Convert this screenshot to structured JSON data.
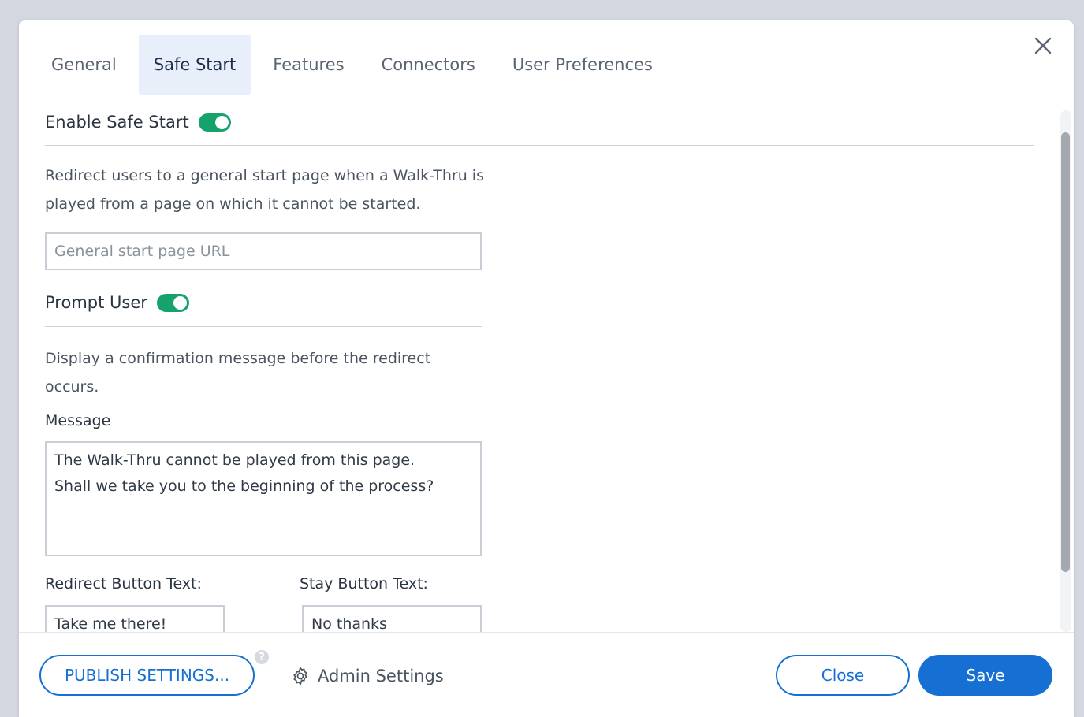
{
  "tabs": [
    {
      "label": "General"
    },
    {
      "label": "Safe Start"
    },
    {
      "label": "Features"
    },
    {
      "label": "Connectors"
    },
    {
      "label": "User Preferences"
    }
  ],
  "active_tab": "Safe Start",
  "safe_start": {
    "enable_label": "Enable Safe Start",
    "enable_on": true,
    "description": "Redirect users to a general start page when a Walk-Thru is played from a page on which it cannot be started.",
    "url_placeholder": "General start page URL",
    "url_value": ""
  },
  "prompt": {
    "label": "Prompt User",
    "enabled": true,
    "description": "Display a confirmation message before the redirect occurs.",
    "message_label": "Message",
    "message_value": "The Walk-Thru cannot be played from this page.\nShall we take you to the beginning of the process?",
    "redirect_label": "Redirect Button Text:",
    "redirect_value": "Take me there!",
    "stay_label": "Stay Button Text:",
    "stay_value": "No thanks"
  },
  "footer": {
    "publish_label": "PUBLISH SETTINGS...",
    "help_glyph": "?",
    "admin_label": "Admin Settings",
    "close_label": "Close",
    "save_label": "Save"
  },
  "colors": {
    "accent": "#1670d4",
    "toggle_on": "#15a26b",
    "active_tab_bg": "#e8eefa"
  },
  "icons": {
    "close": "close-icon",
    "admin": "gear-icon",
    "help": "help-icon"
  }
}
